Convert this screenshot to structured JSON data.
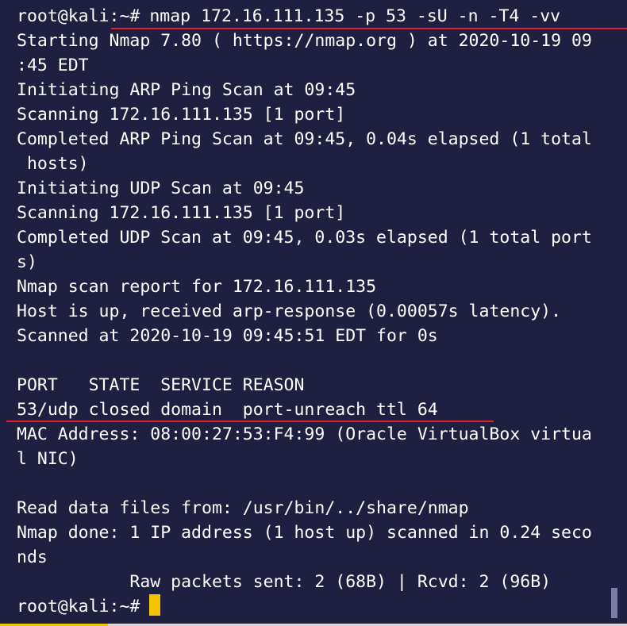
{
  "terminal": {
    "prompt": "root@kali:~#",
    "command": "nmap 172.16.111.135 -p 53 -sU -n -T4 -vv",
    "output_lines": [
      "Starting Nmap 7.80 ( https://nmap.org ) at 2020-10-19 09",
      ":45 EDT",
      "Initiating ARP Ping Scan at 09:45",
      "Scanning 172.16.111.135 [1 port]",
      "Completed ARP Ping Scan at 09:45, 0.04s elapsed (1 total",
      " hosts)",
      "Initiating UDP Scan at 09:45",
      "Scanning 172.16.111.135 [1 port]",
      "Completed UDP Scan at 09:45, 0.03s elapsed (1 total port",
      "s)",
      "Nmap scan report for 172.16.111.135",
      "Host is up, received arp-response (0.00057s latency).",
      "Scanned at 2020-10-19 09:45:51 EDT for 0s",
      "",
      "PORT   STATE  SERVICE REASON",
      "53/udp closed domain  port-unreach ttl 64",
      "MAC Address: 08:00:27:53:F4:99 (Oracle VirtualBox virtua",
      "l NIC)",
      "",
      "Read data files from: /usr/bin/../share/nmap",
      "Nmap done: 1 IP address (1 host up) scanned in 0.24 seco",
      "nds",
      "           Raw packets sent: 2 (68B) | Rcvd: 2 (96B)"
    ],
    "final_prompt": "root@kali:~#"
  },
  "colors": {
    "background": "#1f2041",
    "text": "#ffffff",
    "underline": "#e0202a",
    "cursor": "#f4c400"
  }
}
